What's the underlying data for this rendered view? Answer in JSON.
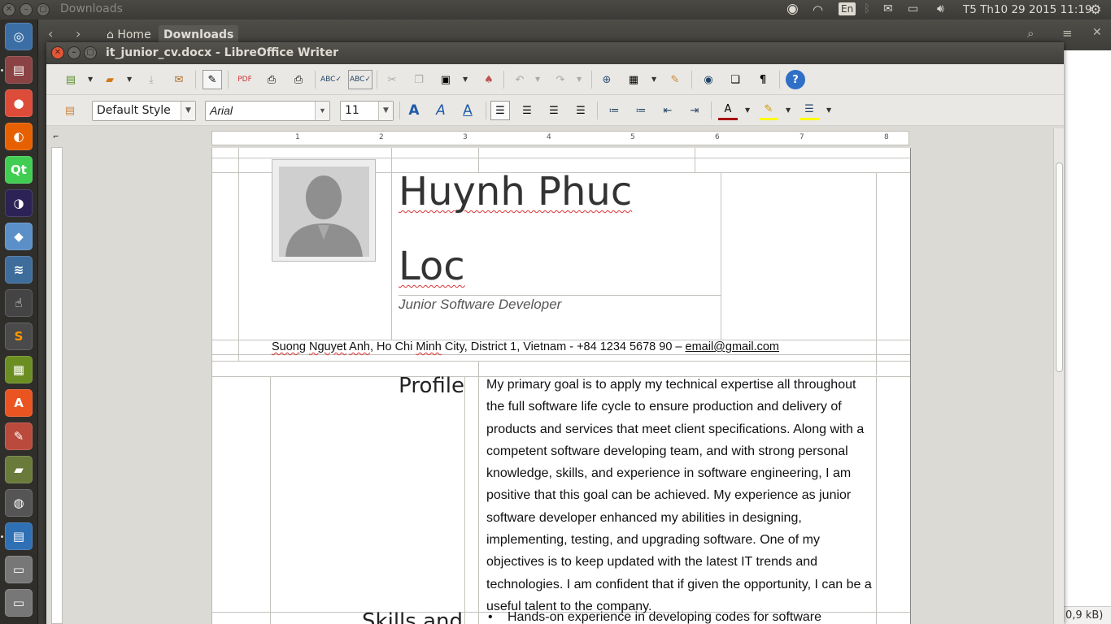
{
  "topbar": {
    "window_title": "Downloads",
    "keyboard_layout": "En",
    "clock": "T5 Th10 29 2015 11:19"
  },
  "nautilus": {
    "breadcrumbs": [
      "Home",
      "Downloads"
    ],
    "status_fragment": "0,9 kB)"
  },
  "writer": {
    "title": "it_junior_cv.docx - LibreOffice Writer",
    "paragraph_style": "Default Style",
    "font_name": "Arial",
    "font_size": "11",
    "ruler_numbers": [
      "1",
      "2",
      "3",
      "4",
      "5",
      "6",
      "7",
      "8"
    ]
  },
  "cv": {
    "name_line1": "Huynh Phuc",
    "name_line2": "Loc",
    "job_title": "Junior Software Developer",
    "contact": {
      "w1": "Suong",
      "w2": "Nguyet",
      "w3": "Anh",
      "m1": ", Ho Chi",
      "w4": "Minh",
      "m2": " City, District 1, Vietnam - +84 1234 5678 90 – ",
      "email": "email@gmail.com"
    },
    "profile_title": "Profile",
    "profile_text": "My primary goal is to apply my technical expertise all throughout the full software life cycle to ensure production and delivery of products and services that meet client specifications. Along with a competent software developing team, and with strong personal knowledge, skills, and experience in software engineering, I am positive that this goal can be achieved. My experience as junior software developer enhanced my abilities in designing, implementing, testing, and upgrading software. One of my objectives is to keep updated with the latest IT trends and technologies. I am confident that if given the opportunity, I can be a useful talent to the company.",
    "skills_title": "Skills and",
    "skills_first_bullet": "Hands-on experience in developing codes for software"
  }
}
